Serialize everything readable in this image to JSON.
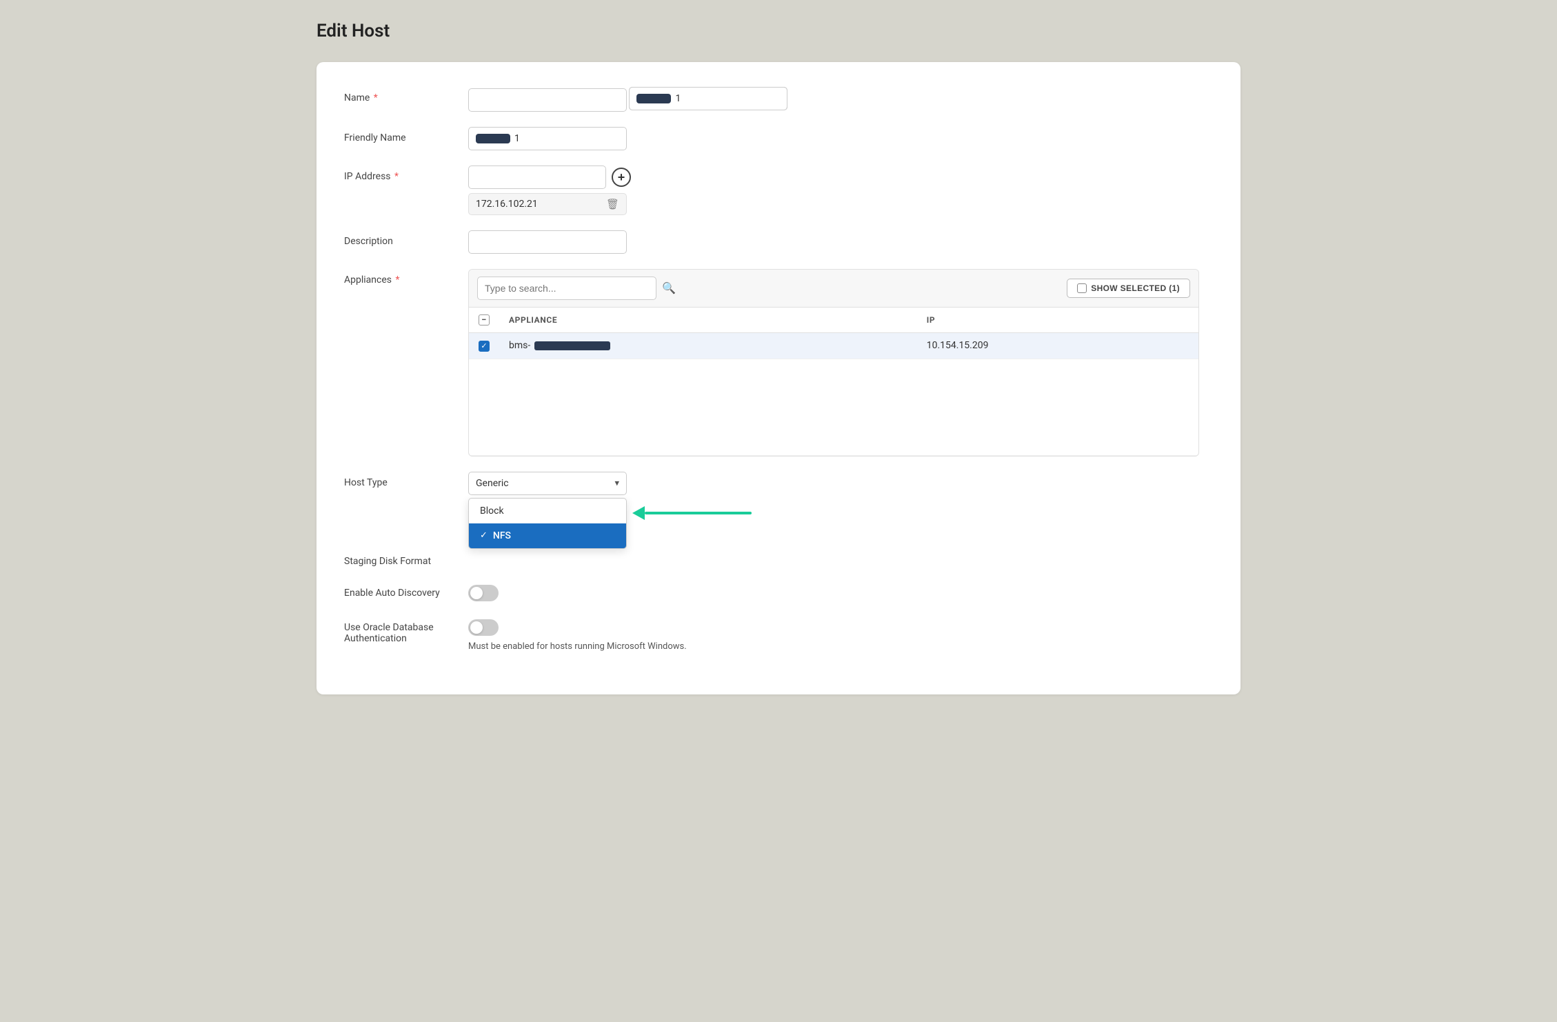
{
  "page": {
    "title": "Edit Host"
  },
  "form": {
    "name_label": "Name",
    "name_required": true,
    "name_value": "1",
    "friendly_name_label": "Friendly Name",
    "friendly_name_value": "1",
    "ip_address_label": "IP Address",
    "ip_address_required": true,
    "ip_address_placeholder": "",
    "ip_existing": "172.16.102.21",
    "description_label": "Description",
    "description_value": "",
    "appliances_label": "Appliances",
    "appliances_required": true,
    "search_placeholder": "Type to search...",
    "show_selected_label": "SHOW SELECTED (1)",
    "appliance_col": "APPLIANCE",
    "ip_col": "IP",
    "appliance_name": "bms-",
    "appliance_ip": "10.154.15.209",
    "host_type_label": "Host Type",
    "host_type_value": "Generic",
    "host_type_options": [
      "Block",
      "NFS"
    ],
    "staging_disk_label": "Staging Disk Format",
    "dropdown_option_block": "Block",
    "dropdown_option_nfs": "NFS",
    "enable_auto_discovery_label": "Enable Auto Discovery",
    "use_oracle_label_line1": "Use Oracle Database",
    "use_oracle_label_line2": "Authentication",
    "oracle_hint": "Must be enabled for hosts running Microsoft Windows."
  }
}
